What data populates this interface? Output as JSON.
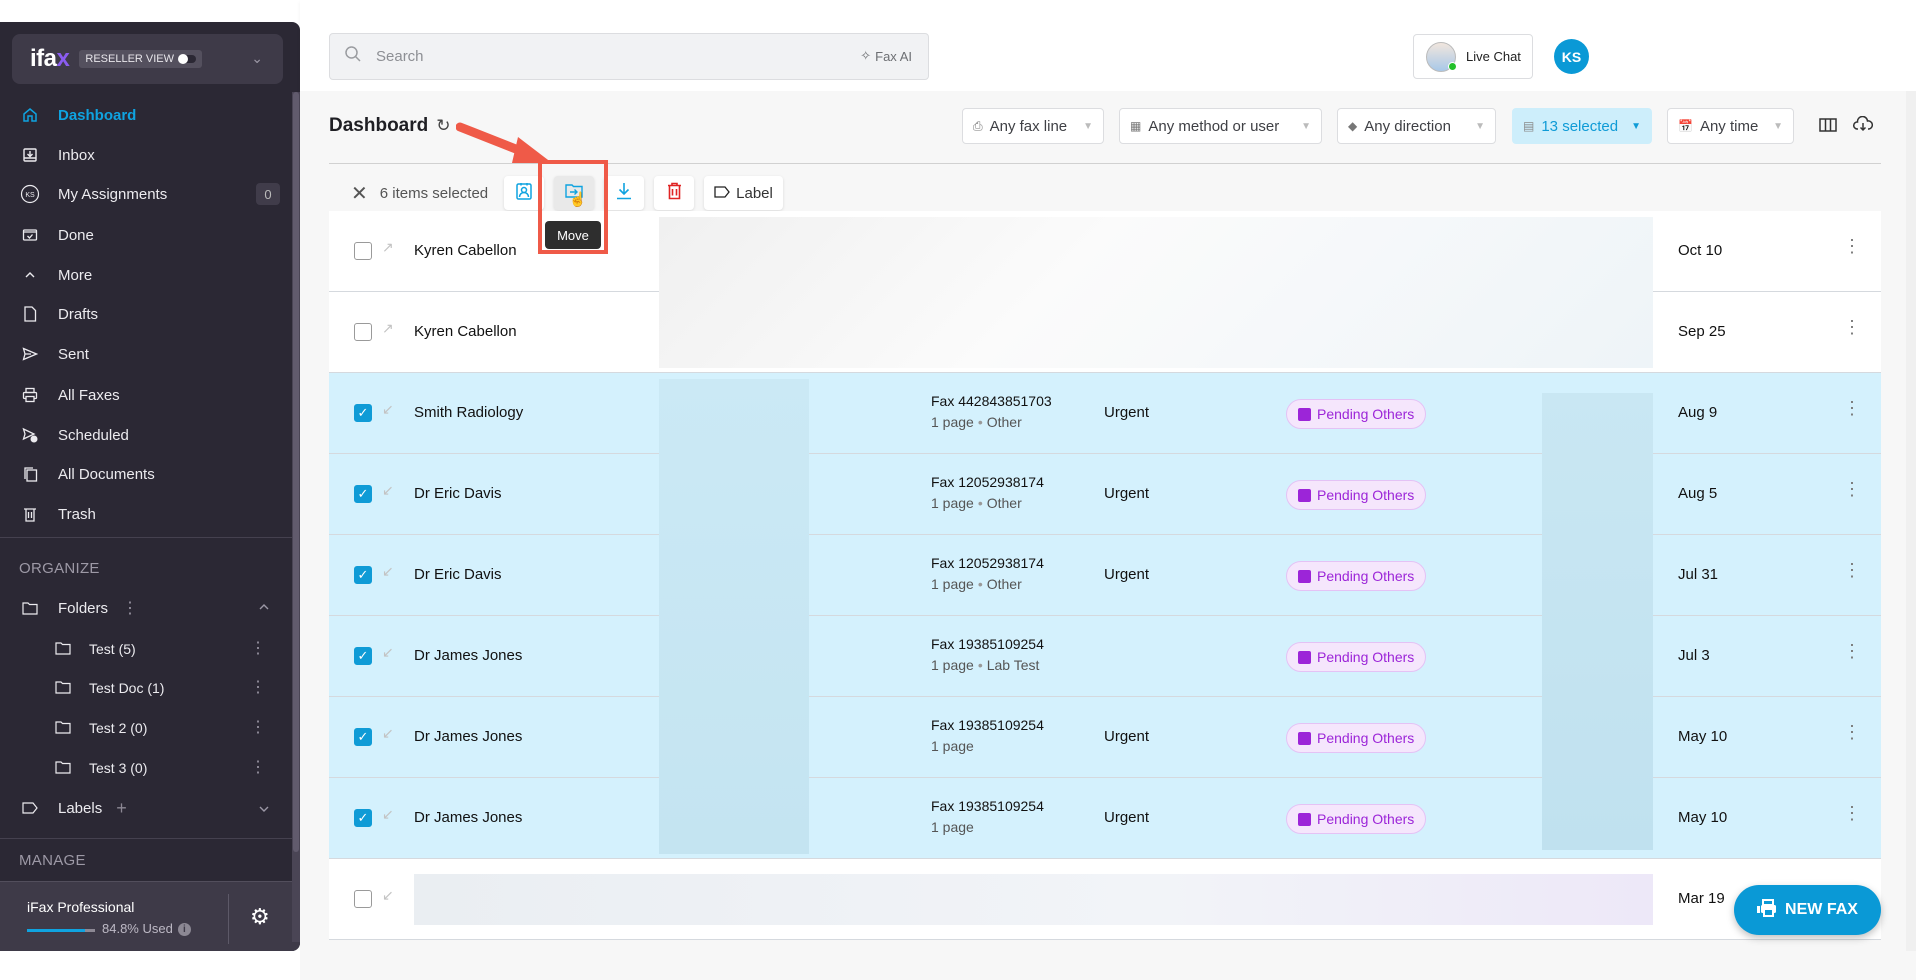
{
  "sidebar": {
    "logo": "ifa",
    "logo_x": "x",
    "reseller_view": "RESELLER VIEW",
    "nav": [
      {
        "label": "Dashboard",
        "icon": "home-icon",
        "active": true
      },
      {
        "label": "Inbox",
        "icon": "inbox-icon"
      },
      {
        "label": "My Assignments",
        "icon": "ks-badge-icon",
        "count": "0"
      },
      {
        "label": "Done",
        "icon": "done-icon"
      },
      {
        "label": "More",
        "icon": "chevron-up-icon"
      },
      {
        "label": "Drafts",
        "icon": "draft-icon"
      },
      {
        "label": "Sent",
        "icon": "send-icon"
      },
      {
        "label": "All Faxes",
        "icon": "printer-icon"
      },
      {
        "label": "Scheduled",
        "icon": "scheduled-icon"
      },
      {
        "label": "All Documents",
        "icon": "documents-icon"
      },
      {
        "label": "Trash",
        "icon": "trash-icon"
      }
    ],
    "organize_label": "ORGANIZE",
    "folders_label": "Folders",
    "folders": [
      {
        "label": "Test (5)"
      },
      {
        "label": "Test Doc (1)"
      },
      {
        "label": "Test 2 (0)"
      },
      {
        "label": "Test 3 (0)"
      }
    ],
    "labels_label": "Labels",
    "manage_label": "MANAGE",
    "plan": {
      "name": "iFax Professional",
      "usage_text": "84.8% Used",
      "usage_fraction": 0.848
    },
    "assign_avatar": "KS"
  },
  "topbar": {
    "search_placeholder": "Search",
    "fax_ai": "Fax AI",
    "live_chat": "Live Chat",
    "user_initials": "KS"
  },
  "main": {
    "title": "Dashboard",
    "filters": {
      "fax_line": "Any fax line",
      "method": "Any method or user",
      "direction": "Any direction",
      "status": "13 selected",
      "time": "Any time"
    },
    "selection": {
      "text": "6 items selected",
      "label_button": "Label",
      "tooltip": "Move"
    },
    "rows": [
      {
        "name": "Kyren Cabellon",
        "selected": false,
        "direction": "outgoing",
        "fax": "",
        "pages": "",
        "tag": "",
        "priority": "",
        "status": "",
        "date": "Oct 10"
      },
      {
        "name": "Kyren Cabellon",
        "selected": false,
        "direction": "outgoing",
        "fax": "",
        "pages": "",
        "tag": "",
        "priority": "",
        "status": "",
        "date": "Sep 25"
      },
      {
        "name": "Smith Radiology",
        "selected": true,
        "direction": "incoming",
        "fax": "Fax 442843851703",
        "pages": "1 page",
        "tag": "Other",
        "priority": "Urgent",
        "status": "Pending Others",
        "date": "Aug 9"
      },
      {
        "name": "Dr Eric Davis",
        "selected": true,
        "direction": "incoming",
        "fax": "Fax 12052938174",
        "pages": "1 page",
        "tag": "Other",
        "priority": "Urgent",
        "status": "Pending Others",
        "date": "Aug 5"
      },
      {
        "name": "Dr Eric Davis",
        "selected": true,
        "direction": "incoming",
        "fax": "Fax 12052938174",
        "pages": "1 page",
        "tag": "Other",
        "priority": "Urgent",
        "status": "Pending Others",
        "date": "Jul 31"
      },
      {
        "name": "Dr James Jones",
        "selected": true,
        "direction": "incoming",
        "fax": "Fax 19385109254",
        "pages": "1 page",
        "tag": "Lab Test",
        "priority": "",
        "status": "Pending Others",
        "date": "Jul 3"
      },
      {
        "name": "Dr James Jones",
        "selected": true,
        "direction": "incoming",
        "fax": "Fax 19385109254",
        "pages": "1 page",
        "tag": "",
        "priority": "Urgent",
        "status": "Pending Others",
        "date": "May 10"
      },
      {
        "name": "Dr James Jones",
        "selected": true,
        "direction": "incoming",
        "fax": "Fax 19385109254",
        "pages": "1 page",
        "tag": "",
        "priority": "Urgent",
        "status": "Pending Others",
        "date": "May 10"
      },
      {
        "name": "",
        "selected": false,
        "direction": "incoming",
        "fax": "",
        "pages": "",
        "tag": "",
        "priority": "",
        "status": "",
        "date": "Mar 19"
      }
    ],
    "new_fax": "NEW FAX"
  },
  "colors": {
    "accent": "#0a99d6",
    "sidebar_bg": "#2b2834",
    "selected_row": "#d4f1fd",
    "status_purple": "#9c25d8",
    "annotation_red": "#ef5a48"
  }
}
